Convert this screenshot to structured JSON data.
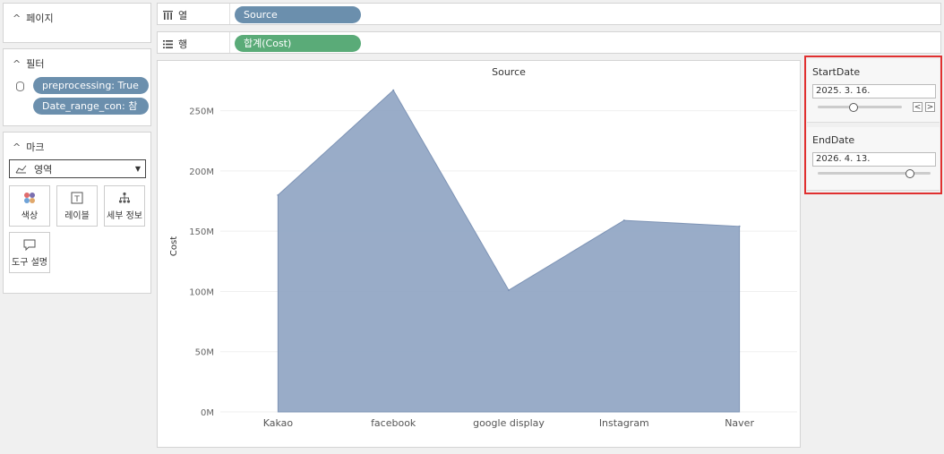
{
  "pages_card": {
    "title": "페이지"
  },
  "filters_card": {
    "title": "필터",
    "items": [
      {
        "label": "preprocessing: True"
      },
      {
        "label": "Date_range_con: 참"
      }
    ]
  },
  "marks_card": {
    "title": "마크",
    "mark_type": "영역",
    "buttons": [
      {
        "label": "색상",
        "icon": "color-dots-icon"
      },
      {
        "label": "레이블",
        "icon": "label-icon"
      },
      {
        "label": "세부 정보",
        "icon": "detail-icon"
      },
      {
        "label": "도구 설명",
        "icon": "tooltip-icon"
      }
    ]
  },
  "shelves": {
    "columns": {
      "label": "열",
      "pill": "Source"
    },
    "rows": {
      "label": "행",
      "pill": "합계(Cost)"
    }
  },
  "parameters": {
    "start": {
      "title": "StartDate",
      "value": "2025. 3. 16.",
      "position": 0.43
    },
    "end": {
      "title": "EndDate",
      "value": "2026. 4. 13.",
      "position": 0.82
    }
  },
  "colors": {
    "area_fill": "#8ea3c2",
    "pill_blue": "#6b8fad",
    "pill_green": "#5aab78",
    "highlight_border": "#e03030"
  },
  "chart_data": {
    "type": "area",
    "title": "Source",
    "xlabel": "",
    "ylabel": "Cost",
    "categories": [
      "Kakao",
      "facebook",
      "google display",
      "Instagram",
      "Naver"
    ],
    "values": [
      180000000,
      267000000,
      101000000,
      159000000,
      154000000
    ],
    "yticks": [
      0,
      50000000,
      100000000,
      150000000,
      200000000,
      250000000
    ],
    "ytick_labels": [
      "0M",
      "50M",
      "100M",
      "150M",
      "200M",
      "250M"
    ],
    "ylim": [
      0,
      275000000
    ],
    "grid": true
  }
}
